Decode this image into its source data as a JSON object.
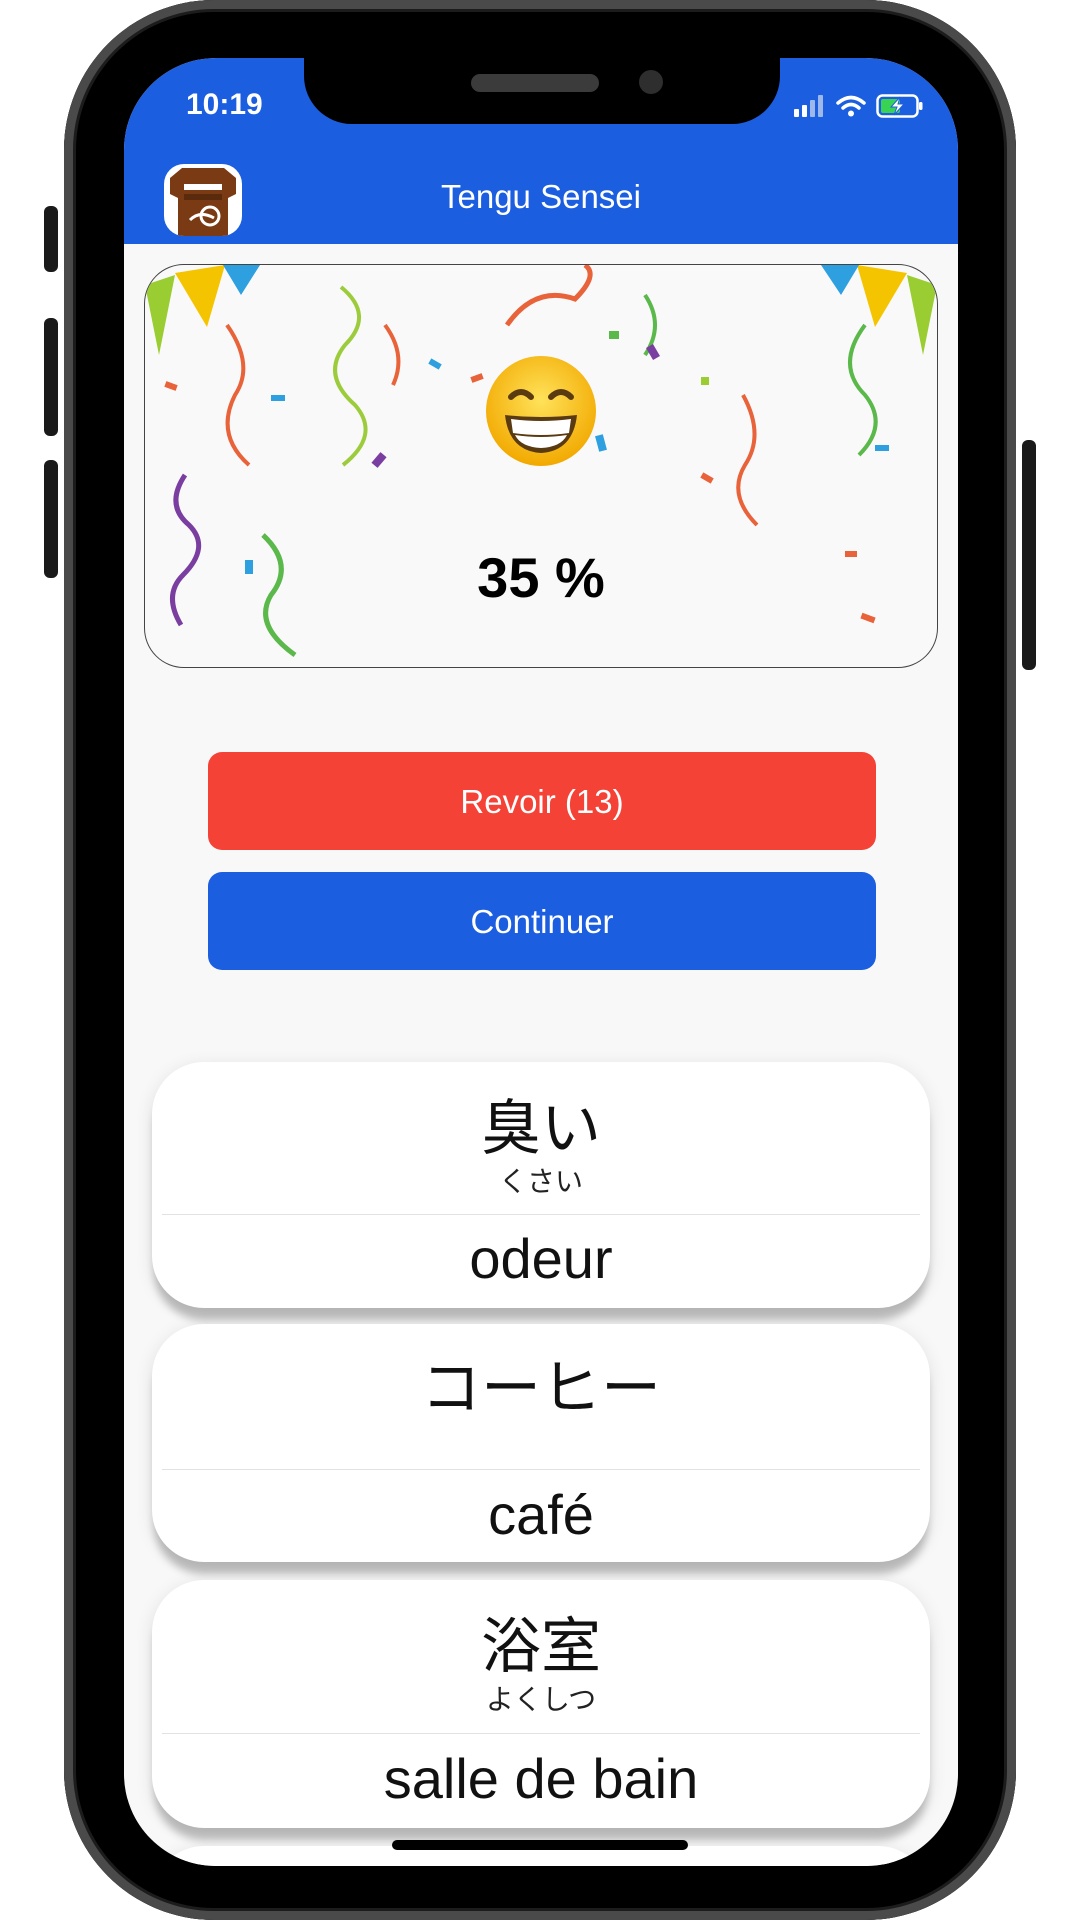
{
  "status_bar": {
    "time": "10:19",
    "icons": [
      "signal-icon",
      "wifi-icon",
      "battery-charging-icon"
    ]
  },
  "header": {
    "title": "Tengu Sensei",
    "logo_icon": "tengu-logo-icon",
    "bar_color": "#1c5ee0"
  },
  "result": {
    "emoji": "grinning-face-emoji",
    "percent": "35 %",
    "background": "confetti"
  },
  "buttons": {
    "review_label": "Revoir (13)",
    "review_color": "#f44336",
    "continue_label": "Continuer",
    "continue_color": "#1c5ee0"
  },
  "words": [
    {
      "japanese": "臭い",
      "reading": "くさい",
      "translation": "odeur"
    },
    {
      "japanese": "コーヒー",
      "reading": "",
      "translation": "café"
    },
    {
      "japanese": "浴室",
      "reading": "よくしつ",
      "translation": "salle de bain"
    }
  ]
}
